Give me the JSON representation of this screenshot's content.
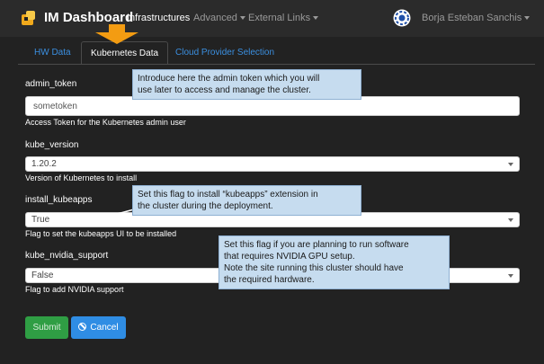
{
  "navbar": {
    "brand": "IM Dashboard",
    "links": [
      {
        "label": "Infrastructures",
        "active": true,
        "dropdown": false
      },
      {
        "label": "Advanced",
        "active": false,
        "dropdown": true
      },
      {
        "label": "External Links",
        "active": false,
        "dropdown": true
      }
    ],
    "user_name": "Borja Esteban Sanchis"
  },
  "tabs": [
    {
      "label": "HW Data",
      "active": false
    },
    {
      "label": "Kubernetes Data",
      "active": true
    },
    {
      "label": "Cloud Provider Selection",
      "active": false
    }
  ],
  "form": {
    "admin_token": {
      "label": "admin_token",
      "value": "sometoken",
      "help": "Access Token for the Kubernetes admin user"
    },
    "kube_version": {
      "label": "kube_version",
      "value": "1.20.2",
      "help": "Version of Kubernetes to install"
    },
    "install_kubeapps": {
      "label": "install_kubeapps",
      "value": "True",
      "help": "Flag to set the kubeapps UI to be installed"
    },
    "kube_nvidia_support": {
      "label": "kube_nvidia_support",
      "value": "False",
      "help": "Flag to add NVIDIA support"
    }
  },
  "callouts": {
    "token": [
      "Introduce here the admin token which you will",
      "use later to access and manage the cluster."
    ],
    "kubeapps": [
      "Set this flag to install “kubeapps” extension in",
      "the cluster during the deployment."
    ],
    "nvidia": [
      "Set this flag if you are planning to run software",
      "that requires NVIDIA GPU setup.",
      "Note the site running this cluster should have",
      "the required hardware."
    ]
  },
  "buttons": {
    "submit": "Submit",
    "cancel": "Cancel"
  },
  "colors": {
    "background": "#222222",
    "navbar": "#2b2b2b",
    "accent": "#2f8de4",
    "submit": "#2f9e44",
    "callout": "#c6dcef",
    "arrow": "#f39c12"
  },
  "icons": {
    "brand": "im-logo-icon",
    "avatar": "egi-avatar-icon",
    "cancel": "ban-icon",
    "pointer": "orange-arrow-icon"
  }
}
